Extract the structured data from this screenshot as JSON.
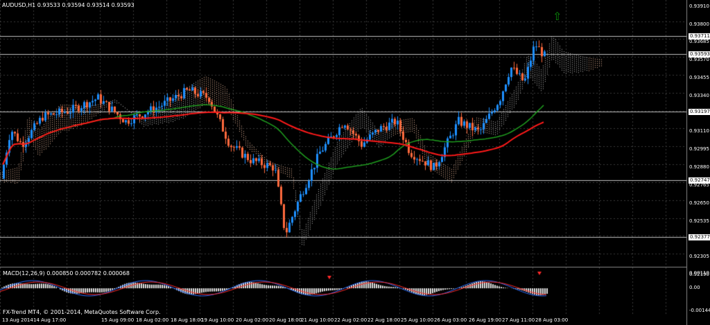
{
  "window": {
    "symbol": "AUDUSD,H1",
    "ohlc": "0.93533 0.93594 0.93514 0.93593",
    "copyright": "FX-Trend MT4, © 2001-2014, MetaQuotes Software Corp."
  },
  "colors": {
    "background": "#000000",
    "grid": "#3a3a3a",
    "bull_candle": "#1e90ff",
    "bear_candle": "#ff6a3d",
    "ma_slow": "#ff1a1a",
    "ma_fast": "#1f9e1f",
    "cloud": "#e8b89a",
    "horizontal_line": "#c0c0c0",
    "signal_up": "#008000"
  },
  "price_axis": {
    "ticks": [
      "0.93910",
      "0.93800",
      "0.93685",
      "0.93570",
      "0.93455",
      "0.93340",
      "0.93225",
      "0.93110",
      "0.92995",
      "0.92880",
      "0.92765",
      "0.92650",
      "0.92535",
      "0.92420",
      "0.92305",
      "0.92190"
    ],
    "line_labels": [
      "0.93711",
      "0.93593",
      "0.93197",
      "0.92747",
      "0.92377"
    ]
  },
  "time_axis": {
    "labels": [
      "13 Aug 2014",
      "14 Aug 17:00",
      "14 Aug 17:00",
      "15 Aug 09:00",
      "18 Aug 02:00",
      "18 Aug 18:00",
      "19 Aug 10:00",
      "20 Aug 02:00",
      "20 Aug 18:00",
      "21 Aug 10:00",
      "22 Aug 02:00",
      "22 Aug 18:00",
      "25 Aug 10:00",
      "26 Aug 03:00",
      "26 Aug 19:00",
      "27 Aug 11:00",
      "28 Aug 03:00"
    ]
  },
  "macd": {
    "label": "MACD(12,26,9) 0.000850 0.000782 0.000068",
    "ticks": [
      "0.00110",
      "0.00",
      "-0.00144"
    ]
  }
}
